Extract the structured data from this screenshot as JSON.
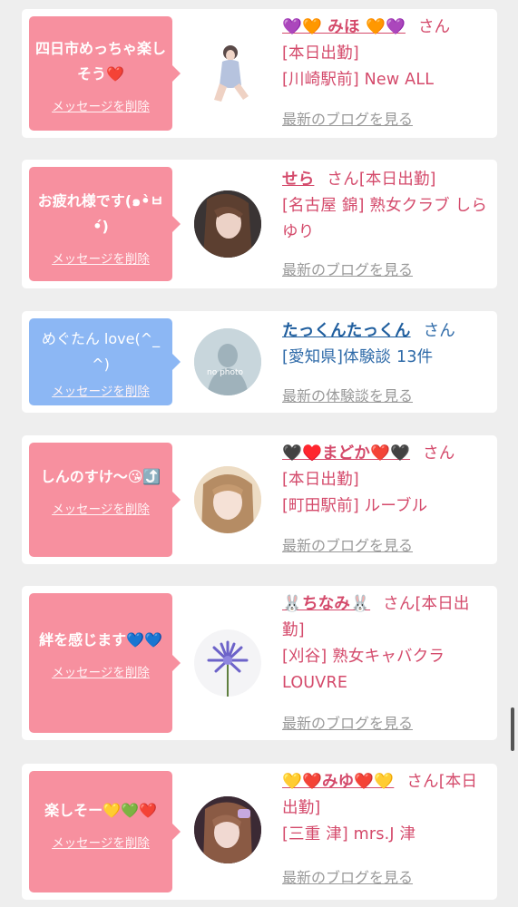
{
  "entries": [
    {
      "message": "四日市めっちゃ楽しそう❤️",
      "delete_label": "メッセージを削除",
      "name": "💜🧡 みほ 🧡💜",
      "san": "さん",
      "line1": "[本日出勤]",
      "line2": "[川崎駅前] New ALL",
      "link": "最新のブログを見る",
      "bubble_color": "pink"
    },
    {
      "message": "お疲れ様です(๑•̀ㅂ•́)",
      "delete_label": "メッセージを削除",
      "name": "せら",
      "san": "さん",
      "line1": "[本日出勤]",
      "line2": "[名古屋 錦] 熟女クラブ しらゆり",
      "link": "最新のブログを見る",
      "bubble_color": "pink"
    },
    {
      "message": "めぐたん love(^_^)",
      "delete_label": "メッセージを削除",
      "name": "たっくんたっくん",
      "san": "さん",
      "line1": "[愛知県]体験談 13件",
      "link": "最新の体験談を見る",
      "avatar_caption": "no photo",
      "bubble_color": "blue"
    },
    {
      "message": "しんのすけ〜😘⤴️",
      "delete_label": "メッセージを削除",
      "name": "🖤♥️まどか❤️🖤",
      "san": "さん",
      "line1": "[本日出勤]",
      "line2": "[町田駅前] ルーブル",
      "link": "最新のブログを見る",
      "bubble_color": "pink"
    },
    {
      "message": "絆を感じます💙💙",
      "delete_label": "メッセージを削除",
      "name": "🐰ちなみ🐰",
      "san": "さん",
      "line1": "[本日出勤]",
      "line2": "[刈谷] 熟女キャバクラ LOUVRE",
      "link": "最新のブログを見る",
      "bubble_color": "pink"
    },
    {
      "message": "楽しそー💛💚❤️",
      "delete_label": "メッセージを削除",
      "name": "💛❤️みゆ❤️💛",
      "san": "さん",
      "line1": "[本日出勤]",
      "line2": "[三重 津] mrs.J 津",
      "link": "最新のブログを見る",
      "bubble_color": "pink"
    }
  ],
  "colors": {
    "background": "#eeeeee",
    "card": "#ffffff",
    "bubble_pink": "#f7909f",
    "bubble_blue": "#8cb7f4",
    "cast_text": "#d44a6b",
    "user_text": "#1f5e9e",
    "link_gray": "#999999"
  },
  "icons": {
    "avatar_1": "woman-photo-avatar",
    "avatar_2": "woman-photo-avatar",
    "avatar_3": "no-photo-placeholder-icon",
    "avatar_4": "woman-photo-avatar",
    "avatar_5": "purple-flower-avatar",
    "avatar_6": "woman-photo-avatar"
  }
}
